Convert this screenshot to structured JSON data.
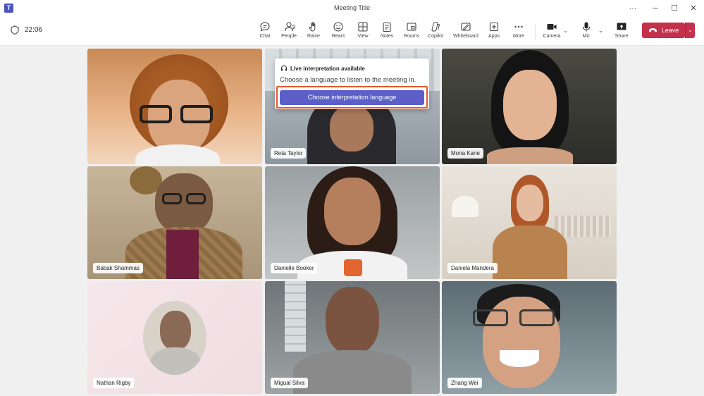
{
  "window": {
    "title": "Meeting Title",
    "more": "···",
    "minimize": "─",
    "maximize": "☐",
    "close": "✕"
  },
  "meeting": {
    "timer": "22:06"
  },
  "toolbar": {
    "chat": "Chat",
    "people": "People",
    "people_count": "9",
    "raise": "Raise",
    "react": "React",
    "view": "View",
    "notes": "Notes",
    "rooms": "Rooms",
    "copilot": "Copilot",
    "whiteboard": "Whiteboard",
    "apps": "Apps",
    "more": "More",
    "camera": "Camera",
    "mic": "Mic",
    "share": "Share",
    "leave": "Leave"
  },
  "popup": {
    "title": "Live interpretation available",
    "body": "Choose a language to listen to the meeting in.",
    "button": "Choose interpretation language"
  },
  "participants": [
    {
      "name": ""
    },
    {
      "name": "Reta Taylor"
    },
    {
      "name": "Mona Kane"
    },
    {
      "name": "Babak Shammas"
    },
    {
      "name": "Danielle Booker"
    },
    {
      "name": "Daniela Mandera"
    },
    {
      "name": "Nathan Rigby"
    },
    {
      "name": "Migual Silva"
    },
    {
      "name": "Zhang Wei"
    }
  ],
  "colors": {
    "accent": "#5b5fc7",
    "leave": "#c4314b",
    "highlight": "#e1582f"
  }
}
